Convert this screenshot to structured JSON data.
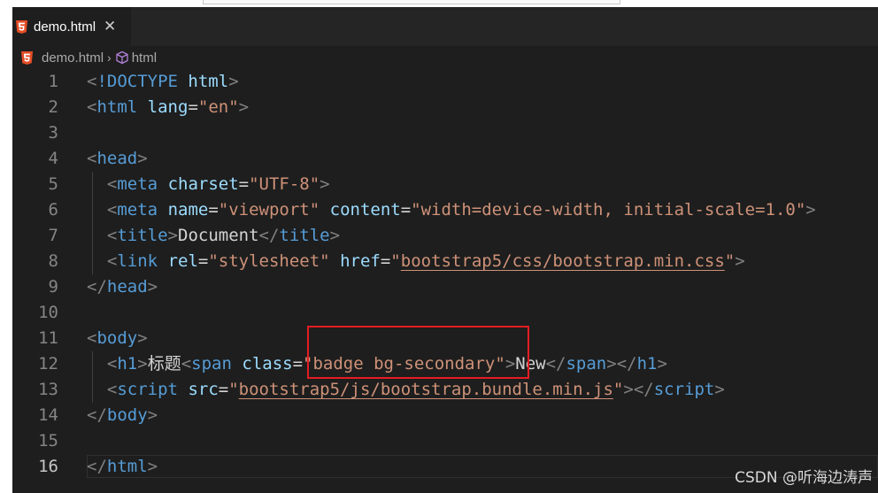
{
  "tab": {
    "label": "demo.html",
    "close_glyph": "✕",
    "icon": "html5-icon"
  },
  "breadcrumb": {
    "file": "demo.html",
    "separator": "›",
    "symbol": "html",
    "symbol_icon": "cube-icon"
  },
  "editor": {
    "current_line": 16,
    "colors": {
      "tag": "#569cd6",
      "attr": "#9cdcfe",
      "str": "#ce9178",
      "punct": "#808080",
      "text": "#d4d4d4",
      "highlight_box": "#e51c23"
    },
    "lines": [
      {
        "num": "1",
        "tokens": [
          [
            "punct",
            "<"
          ],
          [
            "tag",
            "!DOCTYPE"
          ],
          [
            "text",
            " "
          ],
          [
            "attr",
            "html"
          ],
          [
            "punct",
            ">"
          ]
        ]
      },
      {
        "num": "2",
        "tokens": [
          [
            "punct",
            "<"
          ],
          [
            "tag",
            "html"
          ],
          [
            "text",
            " "
          ],
          [
            "attr",
            "lang"
          ],
          [
            "text",
            "="
          ],
          [
            "str",
            "\"en\""
          ],
          [
            "punct",
            ">"
          ]
        ]
      },
      {
        "num": "3",
        "tokens": []
      },
      {
        "num": "4",
        "tokens": [
          [
            "punct",
            "<"
          ],
          [
            "tag",
            "head"
          ],
          [
            "punct",
            ">"
          ]
        ]
      },
      {
        "num": "5",
        "tokens": [
          [
            "text",
            "  "
          ],
          [
            "punct",
            "<"
          ],
          [
            "tag",
            "meta"
          ],
          [
            "text",
            " "
          ],
          [
            "attr",
            "charset"
          ],
          [
            "text",
            "="
          ],
          [
            "str",
            "\"UTF-8\""
          ],
          [
            "punct",
            ">"
          ]
        ]
      },
      {
        "num": "6",
        "tokens": [
          [
            "text",
            "  "
          ],
          [
            "punct",
            "<"
          ],
          [
            "tag",
            "meta"
          ],
          [
            "text",
            " "
          ],
          [
            "attr",
            "name"
          ],
          [
            "text",
            "="
          ],
          [
            "str",
            "\"viewport\""
          ],
          [
            "text",
            " "
          ],
          [
            "attr",
            "content"
          ],
          [
            "text",
            "="
          ],
          [
            "str",
            "\"width=device-width, initial-scale=1.0\""
          ],
          [
            "punct",
            ">"
          ]
        ]
      },
      {
        "num": "7",
        "tokens": [
          [
            "text",
            "  "
          ],
          [
            "punct",
            "<"
          ],
          [
            "tag",
            "title"
          ],
          [
            "punct",
            ">"
          ],
          [
            "text",
            "Document"
          ],
          [
            "punct",
            "</"
          ],
          [
            "tag",
            "title"
          ],
          [
            "punct",
            ">"
          ]
        ]
      },
      {
        "num": "8",
        "tokens": [
          [
            "text",
            "  "
          ],
          [
            "punct",
            "<"
          ],
          [
            "tag",
            "link"
          ],
          [
            "text",
            " "
          ],
          [
            "attr",
            "rel"
          ],
          [
            "text",
            "="
          ],
          [
            "str",
            "\"stylesheet\""
          ],
          [
            "text",
            " "
          ],
          [
            "attr",
            "href"
          ],
          [
            "text",
            "="
          ],
          [
            "str",
            "\""
          ],
          [
            "link",
            "bootstrap5/css/bootstrap.min.css"
          ],
          [
            "str",
            "\""
          ],
          [
            "punct",
            ">"
          ]
        ]
      },
      {
        "num": "9",
        "tokens": [
          [
            "punct",
            "</"
          ],
          [
            "tag",
            "head"
          ],
          [
            "punct",
            ">"
          ]
        ]
      },
      {
        "num": "10",
        "tokens": []
      },
      {
        "num": "11",
        "tokens": [
          [
            "punct",
            "<"
          ],
          [
            "tag",
            "body"
          ],
          [
            "punct",
            ">"
          ]
        ]
      },
      {
        "num": "12",
        "tokens": [
          [
            "text",
            "  "
          ],
          [
            "punct",
            "<"
          ],
          [
            "tag",
            "h1"
          ],
          [
            "punct",
            ">"
          ],
          [
            "text",
            "标题"
          ],
          [
            "punct",
            "<"
          ],
          [
            "tag",
            "span"
          ],
          [
            "text",
            " "
          ],
          [
            "attr",
            "class"
          ],
          [
            "text",
            "="
          ],
          [
            "str",
            "\"badge bg-secondary\""
          ],
          [
            "punct",
            ">"
          ],
          [
            "text",
            "New"
          ],
          [
            "punct",
            "</"
          ],
          [
            "tag",
            "span"
          ],
          [
            "punct",
            "></"
          ],
          [
            "tag",
            "h1"
          ],
          [
            "punct",
            ">"
          ]
        ]
      },
      {
        "num": "13",
        "tokens": [
          [
            "text",
            "  "
          ],
          [
            "punct",
            "<"
          ],
          [
            "tag",
            "script"
          ],
          [
            "text",
            " "
          ],
          [
            "attr",
            "src"
          ],
          [
            "text",
            "="
          ],
          [
            "str",
            "\""
          ],
          [
            "link",
            "bootstrap5/js/bootstrap.bundle.min.js"
          ],
          [
            "str",
            "\""
          ],
          [
            "punct",
            "></"
          ],
          [
            "tag",
            "script"
          ],
          [
            "punct",
            ">"
          ]
        ]
      },
      {
        "num": "14",
        "tokens": [
          [
            "punct",
            "</"
          ],
          [
            "tag",
            "body"
          ],
          [
            "punct",
            ">"
          ]
        ]
      },
      {
        "num": "15",
        "tokens": []
      },
      {
        "num": "16",
        "tokens": [
          [
            "punct",
            "</"
          ],
          [
            "tag",
            "html"
          ],
          [
            "punct",
            ">"
          ]
        ]
      }
    ]
  },
  "watermark": "CSDN @听海边涛声"
}
